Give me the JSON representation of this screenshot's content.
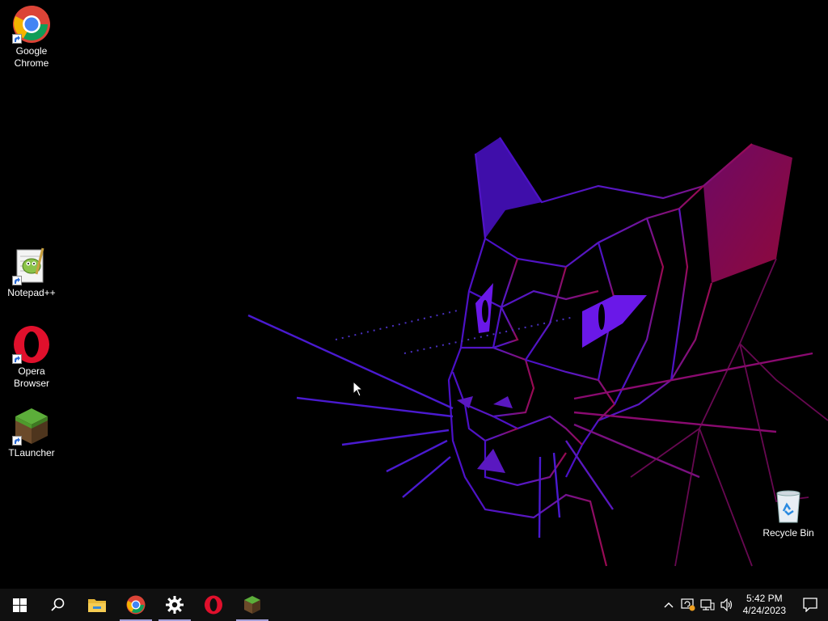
{
  "desktop": {
    "icons": [
      {
        "id": "chrome",
        "label_line1": "Google",
        "label_line2": "Chrome"
      },
      {
        "id": "notepadpp",
        "label_line1": "Notepad++",
        "label_line2": ""
      },
      {
        "id": "opera",
        "label_line1": "Opera",
        "label_line2": "Browser"
      },
      {
        "id": "tlauncher",
        "label_line1": "TLauncher",
        "label_line2": ""
      },
      {
        "id": "recycle",
        "label_line1": "Recycle Bin",
        "label_line2": ""
      }
    ]
  },
  "taskbar": {
    "start_icon": "windows-logo-icon",
    "search_icon": "search-icon",
    "pinned": [
      {
        "name": "file-explorer-icon",
        "running": false
      },
      {
        "name": "chrome-icon",
        "running": true
      },
      {
        "name": "settings-gear-icon",
        "running": true
      },
      {
        "name": "opera-icon",
        "running": false
      },
      {
        "name": "tlauncher-icon",
        "running": true
      }
    ],
    "tray": {
      "time": "5:42 PM",
      "date": "4/24/2023",
      "icons": [
        "chevron-up-icon",
        "windows-update-icon",
        "network-icon",
        "volume-icon",
        "notifications-icon"
      ]
    }
  },
  "colors": {
    "taskbar_bg": "#101010",
    "wallpaper_bg": "#000000",
    "purple": "#5a14d0",
    "magenta": "#9a0a55"
  }
}
